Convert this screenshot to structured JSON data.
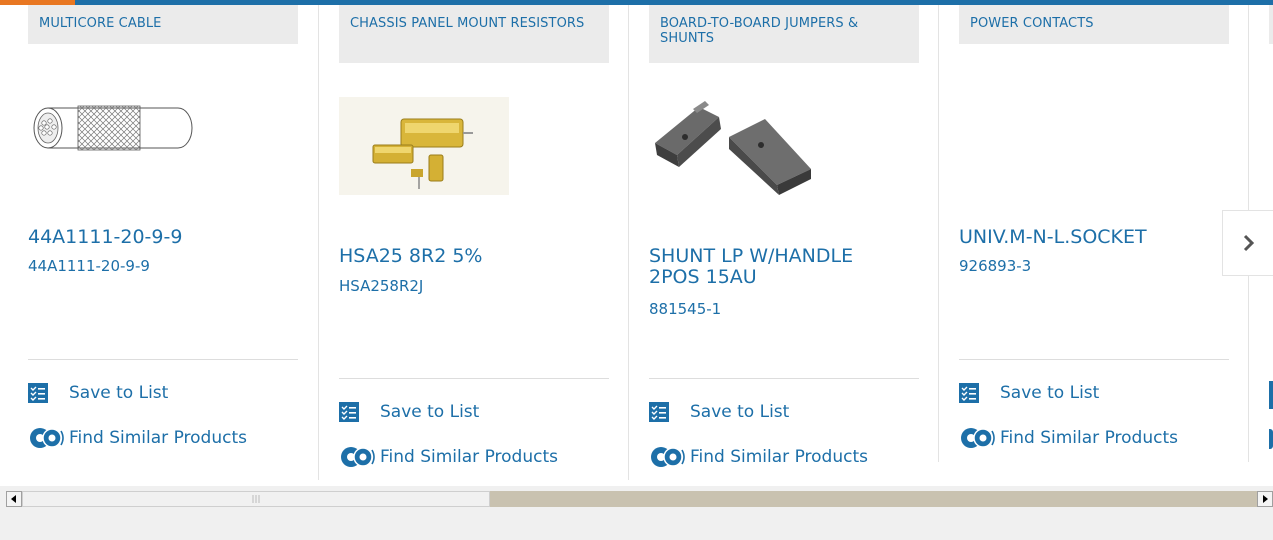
{
  "products": [
    {
      "category": "MULTICORE CABLE",
      "name": "44A1111-20-9-9",
      "part_number": "44A1111-20-9-9",
      "image_icon": "multicore-cable-image"
    },
    {
      "category": "CHASSIS PANEL MOUNT RESISTORS",
      "name": "HSA25 8R2 5%",
      "part_number": "HSA258R2J",
      "image_icon": "resistor-image"
    },
    {
      "category": "BOARD-TO-BOARD JUMPERS & SHUNTS",
      "name": "SHUNT LP W/HANDLE 2POS 15AU",
      "part_number": "881545-1",
      "image_icon": "shunt-image"
    },
    {
      "category": "POWER CONTACTS",
      "name": "UNIV.M-N-L.SOCKET",
      "part_number": "926893-3",
      "image_icon": null
    }
  ],
  "actions": {
    "save_label": "Save to List",
    "similar_label": "Find Similar Products"
  },
  "carousel": {
    "next_icon": "chevron-right-icon"
  },
  "colors": {
    "link": "#1d6fa8",
    "category_bg": "#ebebeb",
    "accent": "#e87722",
    "topbar": "#1d6fa8"
  }
}
